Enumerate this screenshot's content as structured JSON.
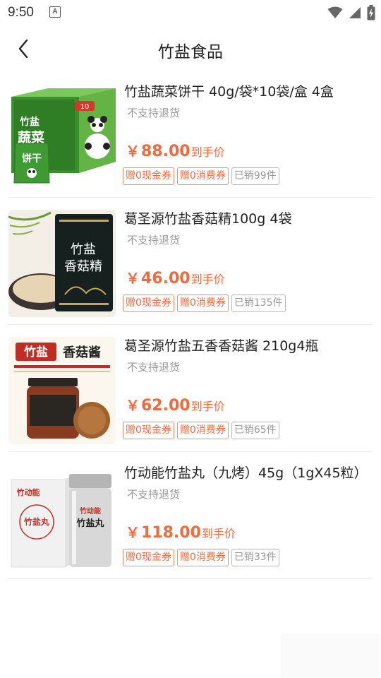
{
  "status_bar": {
    "time": "9:50",
    "notification_icon": "A"
  },
  "header": {
    "title": "竹盐食品"
  },
  "icons": {
    "back": "chevron-left-icon",
    "wifi": "wifi-icon",
    "signal": "signal-icon",
    "battery": "battery-charging-icon"
  },
  "colors": {
    "accent": "#ef6a3f",
    "tag_border": "#ef8f6b",
    "muted": "#999999"
  },
  "products": [
    {
      "title": "竹盐蔬菜饼干 40g/袋*10袋/盒 4盒",
      "note": "不支持退货",
      "currency": "￥",
      "price": "88.00",
      "price_suffix": "到手价",
      "coupon_tag": "赠0现金券",
      "consume_tag": "赠0消费券",
      "sold": "已销99件",
      "image_text": {
        "top": "竹盐",
        "main": "蔬菜",
        "bag_main": "饼干",
        "badge": "10"
      }
    },
    {
      "title": "葛圣源竹盐香菇精100g 4袋",
      "note": "不支持退货",
      "currency": "￥",
      "price": "46.00",
      "price_suffix": "到手价",
      "coupon_tag": "赠0现金券",
      "consume_tag": "赠0消费券",
      "sold": "已销135件",
      "image_text": {
        "line1": "竹盐",
        "line2": "香菇精"
      }
    },
    {
      "title": "葛圣源竹盐五香香菇酱 210g4瓶",
      "note": "不支持退货",
      "currency": "￥",
      "price": "62.00",
      "price_suffix": "到手价",
      "coupon_tag": "赠0现金券",
      "consume_tag": "赠0消费券",
      "sold": "已销65件",
      "image_text": {
        "highlight": "竹盐",
        "rest": "香菇酱"
      }
    },
    {
      "title": "竹动能竹盐丸（九烤）45g（1gX45粒）",
      "note": "不支持退货",
      "currency": "￥",
      "price": "118.00",
      "price_suffix": "到手价",
      "coupon_tag": "赠0现金券",
      "consume_tag": "赠0消费券",
      "sold": "已销33件",
      "image_text": {
        "brand": "竹动能",
        "box_main": "竹盐丸",
        "jar_main": "竹盐丸"
      }
    }
  ]
}
